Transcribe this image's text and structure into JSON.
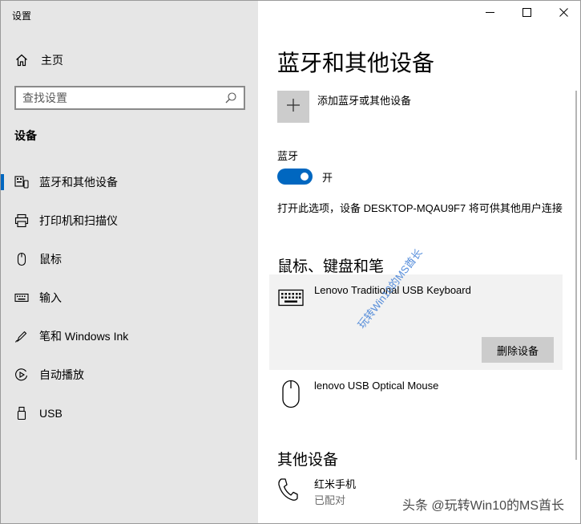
{
  "window": {
    "title": "设置",
    "controls": {
      "minimize": "minimize-icon",
      "maximize": "maximize-icon",
      "close": "close-icon"
    }
  },
  "sidebar": {
    "home_label": "主页",
    "search_placeholder": "查找设置",
    "section_title": "设备",
    "items": [
      {
        "label": "蓝牙和其他设备",
        "icon": "bluetooth-devices-icon",
        "active": true
      },
      {
        "label": "打印机和扫描仪",
        "icon": "printer-icon",
        "active": false
      },
      {
        "label": "鼠标",
        "icon": "mouse-icon",
        "active": false
      },
      {
        "label": "输入",
        "icon": "keyboard-icon",
        "active": false
      },
      {
        "label": "笔和 Windows Ink",
        "icon": "pen-icon",
        "active": false
      },
      {
        "label": "自动播放",
        "icon": "autoplay-icon",
        "active": false
      },
      {
        "label": "USB",
        "icon": "usb-icon",
        "active": false
      }
    ]
  },
  "main": {
    "title": "蓝牙和其他设备",
    "add_device_label": "添加蓝牙或其他设备",
    "bluetooth": {
      "label": "蓝牙",
      "state_label": "开",
      "enabled": true,
      "description": "打开此选项，设备 DESKTOP-MQAU9F7 将可供其他用户连接"
    },
    "mouse_keyboard_pen": {
      "title": "鼠标、键盘和笔",
      "devices": [
        {
          "name": "Lenovo Traditional USB Keyboard",
          "icon": "keyboard-icon",
          "selected": true,
          "action_label": "删除设备"
        },
        {
          "name": "lenovo USB Optical Mouse",
          "icon": "mouse-icon",
          "selected": false
        }
      ]
    },
    "other_devices": {
      "title": "其他设备",
      "devices": [
        {
          "name": "红米手机",
          "status": "已配对",
          "icon": "phone-icon"
        }
      ]
    }
  },
  "watermarks": {
    "diagonal": "玩转Win10的MS酋长",
    "footer": "头条 @玩转Win10的MS酋长"
  },
  "colors": {
    "accent": "#0067c0",
    "sidebar_bg": "#e6e6e6",
    "selected_card_bg": "#f2f2f2",
    "button_bg": "#cccccc"
  }
}
